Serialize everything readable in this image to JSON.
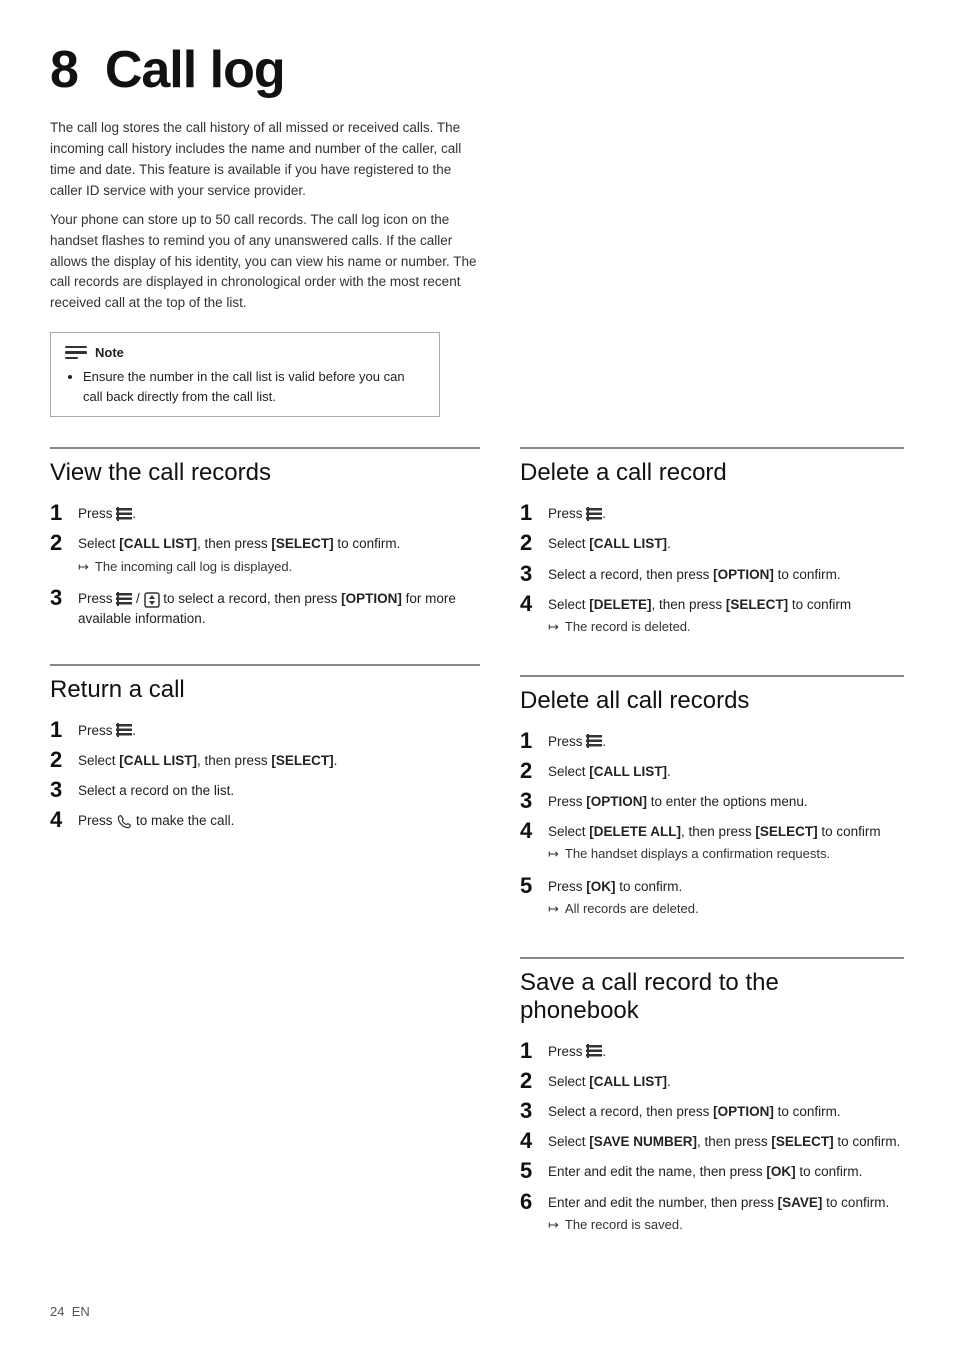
{
  "page": {
    "chapter": "8",
    "title": "Call log",
    "page_number": "24",
    "lang": "EN"
  },
  "intro": {
    "paragraphs": [
      "The call log stores the call history of all missed or received calls. The incoming call history includes the name and number of the caller, call time and date. This feature is available if you have registered to the caller ID service with your service provider.",
      "Your phone can store up to 50 call records. The call log icon on the handset flashes to remind you of any unanswered calls. If the caller allows the display of his identity, you can view his name or number. The call records are displayed in chronological order with the most recent received call at the top of the list."
    ],
    "note": {
      "label": "Note",
      "items": [
        "Ensure the number in the call list is valid before you can call back directly from the call list."
      ]
    }
  },
  "sections": {
    "view": {
      "title": "View the call records",
      "steps": [
        {
          "num": "1",
          "text": "Press [list-icon]."
        },
        {
          "num": "2",
          "text": "Select [CALL LIST], then press [SELECT] to confirm.",
          "result": "The incoming call log is displayed."
        },
        {
          "num": "3",
          "text": "Press [list-icon] / [nav-icon] to select a record, then press [OPTION] for more available information."
        }
      ]
    },
    "return": {
      "title": "Return a call",
      "steps": [
        {
          "num": "1",
          "text": "Press [list-icon]."
        },
        {
          "num": "2",
          "text": "Select [CALL LIST], then press [SELECT]."
        },
        {
          "num": "3",
          "text": "Select a record on the list."
        },
        {
          "num": "4",
          "text": "Press [phone-icon] to make the call."
        }
      ]
    },
    "delete": {
      "title": "Delete a call record",
      "steps": [
        {
          "num": "1",
          "text": "Press [list-icon]."
        },
        {
          "num": "2",
          "text": "Select [CALL LIST]."
        },
        {
          "num": "3",
          "text": "Select a record, then press [OPTION] to confirm."
        },
        {
          "num": "4",
          "text": "Select [DELETE], then press [SELECT] to confirm",
          "result": "The record is deleted."
        }
      ]
    },
    "delete_all": {
      "title": "Delete all call records",
      "steps": [
        {
          "num": "1",
          "text": "Press [list-icon]."
        },
        {
          "num": "2",
          "text": "Select [CALL LIST]."
        },
        {
          "num": "3",
          "text": "Press [OPTION] to enter the options menu."
        },
        {
          "num": "4",
          "text": "Select [DELETE ALL], then press [SELECT] to confirm",
          "result": "The handset displays a confirmation requests."
        },
        {
          "num": "5",
          "text": "Press [OK] to confirm.",
          "result": "All records are deleted."
        }
      ]
    },
    "save": {
      "title": "Save a call record to the phonebook",
      "steps": [
        {
          "num": "1",
          "text": "Press [list-icon]."
        },
        {
          "num": "2",
          "text": "Select [CALL LIST]."
        },
        {
          "num": "3",
          "text": "Select a record, then press [OPTION] to confirm."
        },
        {
          "num": "4",
          "text": "Select [SAVE NUMBER], then press [SELECT] to confirm."
        },
        {
          "num": "5",
          "text": "Enter and edit the name, then press [OK] to confirm."
        },
        {
          "num": "6",
          "text": "Enter and edit the number, then press [SAVE] to confirm.",
          "result": "The record is saved."
        }
      ]
    }
  },
  "labels": {
    "bold": {
      "CALL_LIST": "[CALL LIST]",
      "SELECT": "[SELECT]",
      "OPTION": "[OPTION]",
      "DELETE": "[DELETE]",
      "DELETE_ALL": "[DELETE ALL]",
      "OK": "[OK]",
      "SAVE_NUMBER": "[SAVE NUMBER]",
      "SAVE": "[SAVE]"
    }
  }
}
